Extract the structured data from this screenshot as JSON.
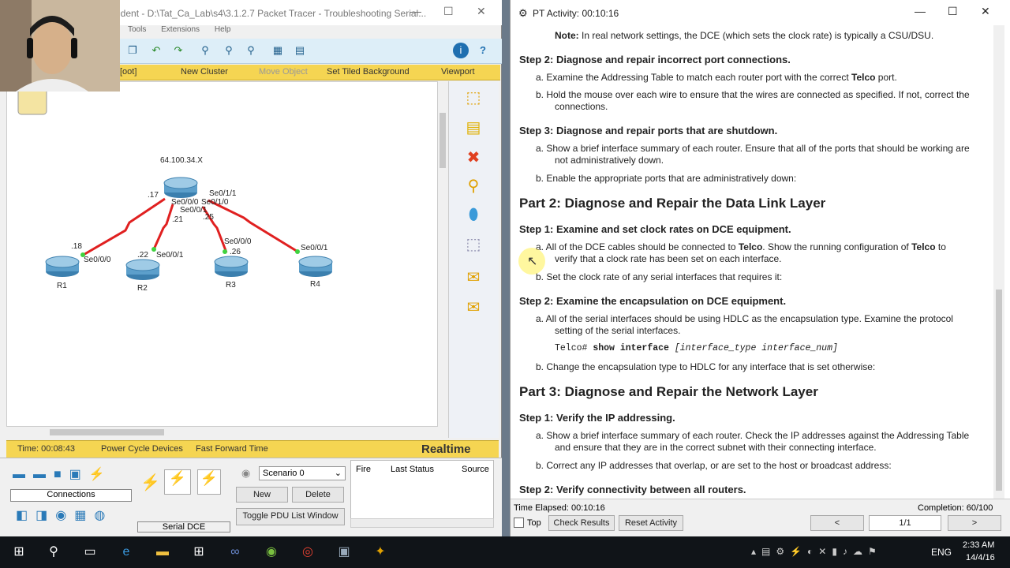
{
  "pt": {
    "title": "ident - D:\\Tat_Ca_Lab\\s4\\3.1.2.7 Packet Tracer - Troubleshooting Serial...",
    "menu": [
      "Tools",
      "Extensions",
      "Help"
    ],
    "yellow_bar": [
      "[oot]",
      "New Cluster",
      "Move Object",
      "Set Tiled Background",
      "Viewport"
    ],
    "network": {
      "cloud_label": "64.100.34.X",
      "center_labels": [
        ".17",
        "Se0/0/0",
        "Se0/1/0",
        "Se0/1/1",
        "Se0/0/1",
        ".21",
        ".25"
      ],
      "routers": [
        {
          "name": "R1",
          "ip": ".18",
          "iface": "Se0/0/0"
        },
        {
          "name": "R2",
          "ip": ".22",
          "iface": "Se0/0/1"
        },
        {
          "name": "R3",
          "ip": ".26",
          "iface": "Se0/0/0"
        },
        {
          "name": "R4",
          "ip": "",
          "iface": "Se0/0/1"
        }
      ]
    },
    "status_bar": {
      "time": "Time: 00:08:43",
      "power": "Power Cycle Devices",
      "fast": "Fast Forward Time",
      "mode": "Realtime"
    },
    "bottom": {
      "connections_label": "Connections",
      "conn_type": "Serial DCE",
      "scenario": "Scenario 0",
      "new_btn": "New",
      "delete_btn": "Delete",
      "toggle_btn": "Toggle PDU List Window",
      "table_headers": [
        "Fire",
        "Last Status",
        "Source"
      ]
    }
  },
  "activity": {
    "title": "PT Activity: 00:10:16",
    "doc": {
      "note_label": "Note:",
      "note_text": " In real network settings, the DCE (which sets the clock rate) is typically a CSU/DSU.",
      "s2": "Step 2:  Diagnose and repair incorrect port connections.",
      "s2a_1": "a.   Examine the Addressing Table to match each router port with the correct ",
      "s2a_bold": "Telco",
      "s2a_2": " port.",
      "s2b_1": "b.   Hold the mouse over each wire to ensure that the wires are connected as specified. If not, correct the",
      "s2b_2": "connections.",
      "s3": "Step 3:  Diagnose and repair ports that are shutdown.",
      "s3a_1": "a.   Show a brief interface summary of each router. Ensure that all of the ports that should be working are",
      "s3a_2": "not administratively down.",
      "s3b": "b.   Enable the appropriate ports that are administratively down:",
      "p2": "Part 2:  Diagnose and Repair the Data Link Layer",
      "p2s1": "Step 1:  Examine and set clock rates on DCE equipment.",
      "p2s1a_1": "a.   All of the DCE cables should be connected to ",
      "p2s1a_b1": "Telco",
      "p2s1a_2": ". Show the running configuration of ",
      "p2s1a_b2": "Telco",
      "p2s1a_3": " to",
      "p2s1a_4": "verify that a clock rate has been set on each interface.",
      "p2s1b": "b.   Set the clock rate of any serial interfaces that requires it:",
      "p2s2": "Step 2:  Examine the encapsulation on DCE equipment.",
      "p2s2a_1": "a.   All of the serial interfaces should be using HDLC as the encapsulation type. Examine the protocol",
      "p2s2a_2": "setting of the serial interfaces.",
      "cmd_prompt": "Telco# ",
      "cmd_bold": "show interface ",
      "cmd_ital": "[interface_type interface_num]",
      "p2s2b": "b.   Change the encapsulation type to HDLC for any interface that is set otherwise:",
      "p3": "Part 3:  Diagnose and Repair the Network Layer",
      "p3s1": "Step 1:  Verify the IP addressing.",
      "p3s1a_1": "a.   Show a brief interface summary of each router. Check the IP addresses against the Addressing Table",
      "p3s1a_2": "and ensure that they are in the correct subnet with their connecting interface.",
      "p3s1b": "b.   Correct any IP addresses that overlap, or are set to the host or broadcast address:",
      "p3s2": "Step 2:  Verify connectivity between all routers."
    },
    "footer": {
      "elapsed": "Time Elapsed: 00:10:16",
      "completion": "Completion: 60/100",
      "top_label": "Top",
      "check_btn": "Check Results",
      "reset_btn": "Reset Activity",
      "prev_btn": "<",
      "page": "1/1",
      "next_btn": ">"
    }
  },
  "taskbar": {
    "lang": "ENG",
    "time": "2:33 AM",
    "date": "14/4/16"
  }
}
